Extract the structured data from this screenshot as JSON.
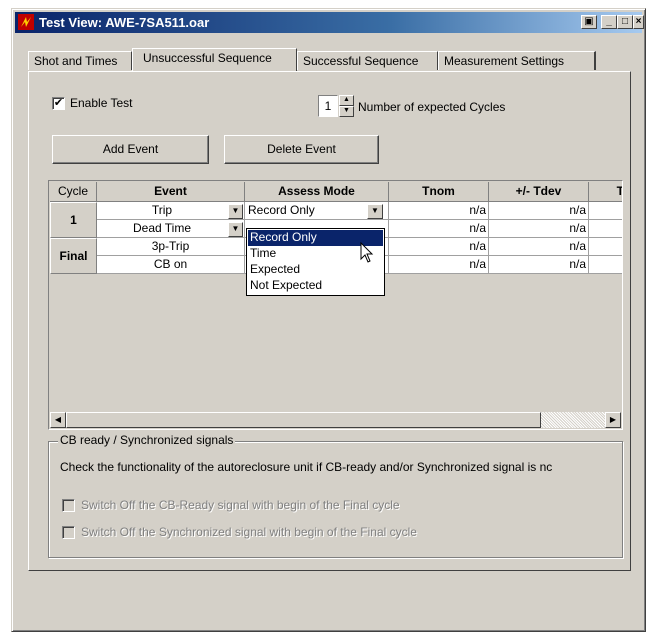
{
  "window": {
    "title": "Test View: AWE-7SA511.oar",
    "controls": [
      "restore",
      "minimize",
      "maximize",
      "close"
    ]
  },
  "tabs": [
    {
      "label": "Shot and Times",
      "active": false
    },
    {
      "label": "Unsuccessful Sequence",
      "active": true
    },
    {
      "label": "Successful Sequence",
      "active": false
    },
    {
      "label": "Measurement Settings",
      "active": false
    }
  ],
  "enable_test": {
    "label": "Enable Test",
    "checked": true
  },
  "cycles": {
    "value": "1",
    "label": "Number of expected Cycles"
  },
  "buttons": {
    "add_event": "Add Event",
    "delete_event": "Delete Event"
  },
  "grid": {
    "columns": [
      "Cycle",
      "Event",
      "Assess Mode",
      "Tnom",
      "+/- Tdev",
      "T"
    ],
    "row_headers": [
      "1",
      "Final"
    ],
    "rows": [
      {
        "event": "Trip",
        "assess": "Record Only",
        "tnom": "n/a",
        "tdev": "n/a"
      },
      {
        "event": "Dead Time",
        "assess": "",
        "tnom": "n/a",
        "tdev": "n/a"
      },
      {
        "event": "3p-Trip",
        "assess": "",
        "tnom": "n/a",
        "tdev": "n/a"
      },
      {
        "event": "CB on",
        "assess": "",
        "tnom": "n/a",
        "tdev": "n/a"
      }
    ]
  },
  "assess_dropdown": {
    "options": [
      "Record Only",
      "Time",
      "Expected",
      "Not Expected"
    ],
    "selected": "Record Only"
  },
  "cb_group": {
    "title": "CB ready / Synchronized signals",
    "description": "Check the functionality of the autoreclosure unit if CB-ready and/or Synchronized signal is nc",
    "option1": "Switch Off the CB-Ready signal with begin of the Final cycle",
    "option2": "Switch Off the Synchronized signal with begin of the Final cycle"
  },
  "icons": [
    "app-icon",
    "checkbox-check-icon",
    "spin-up-icon",
    "spin-down-icon",
    "dropdown-arrow-icon",
    "scroll-left-icon",
    "scroll-right-icon",
    "mouse-cursor-icon"
  ]
}
